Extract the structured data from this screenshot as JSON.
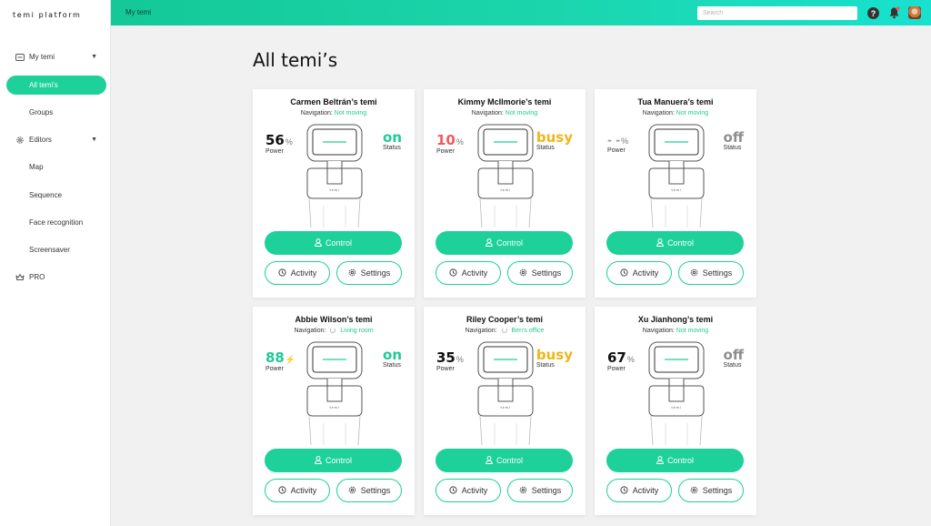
{
  "app": {
    "brand": "temi platform"
  },
  "topbar": {
    "breadcrumb": "My temi",
    "search_placeholder": "Search",
    "help_label": "?"
  },
  "sidebar": {
    "items": [
      {
        "label": "My temi",
        "icon": "robot-icon",
        "chevron": "▼"
      },
      {
        "label": "All temi's"
      },
      {
        "label": "Groups"
      },
      {
        "label": "Editors",
        "icon": "gear-icon",
        "chevron": "▼"
      },
      {
        "label": "Map"
      },
      {
        "label": "Sequence"
      },
      {
        "label": "Face recognition"
      },
      {
        "label": "Screensaver"
      },
      {
        "label": "PRO",
        "icon": "crown-icon"
      }
    ]
  },
  "main": {
    "title": "All temi’s"
  },
  "labels": {
    "navigation": "Navigation:",
    "power": "Power",
    "status": "Status",
    "control": "Control",
    "activity": "Activity",
    "settings": "Settings",
    "percent": "%"
  },
  "colors": {
    "accent": "#1ed09a",
    "busy": "#f2b418",
    "off": "#8e8e8e",
    "low": "#f0595d"
  },
  "cards": [
    {
      "name": "Carmen Beltrán’s temi",
      "nav_status": "Not moving",
      "power": "56",
      "power_unit": "%",
      "status": "on"
    },
    {
      "name": "Kimmy McIlmorie’s temi",
      "nav_status": "Not moving",
      "power": "10",
      "power_unit": "%",
      "status": "busy"
    },
    {
      "name": "Tua Manuera’s temi",
      "nav_status": "Not moving",
      "power": "- -",
      "power_unit": "%",
      "status": "off"
    },
    {
      "name": "Abbie Wilson’s temi",
      "nav_status": "Living room",
      "power": "88",
      "power_unit": "⚡",
      "status": "on"
    },
    {
      "name": "Riley Cooper’s temi",
      "nav_status": "Ben's office",
      "power": "35",
      "power_unit": "%",
      "status": "busy"
    },
    {
      "name": "Xu Jianhong’s temi",
      "nav_status": "Not moving",
      "power": "67",
      "power_unit": "%",
      "status": "off"
    }
  ]
}
